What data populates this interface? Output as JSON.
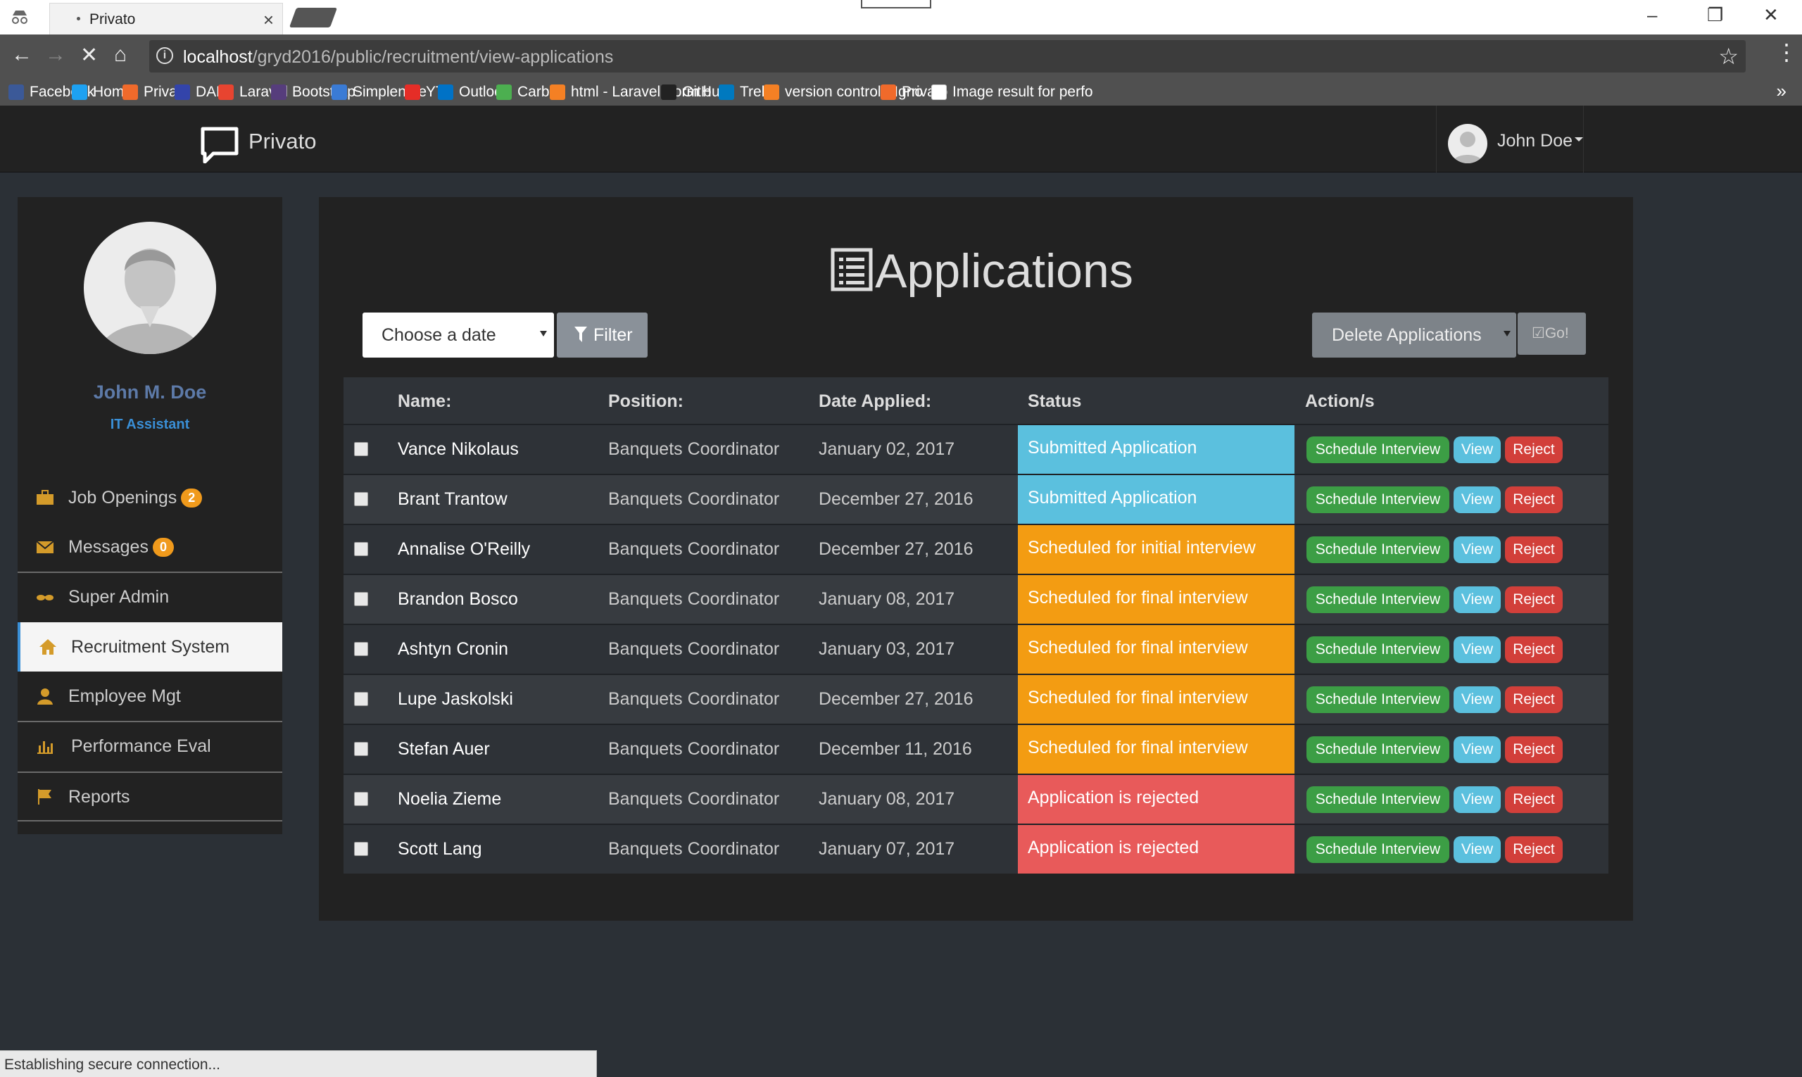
{
  "browser": {
    "tab_title": "Privato",
    "tab_close": "×",
    "url_host": "localhost",
    "url_path": "/gryd2016/public/recruitment/view-applications",
    "bookmarks": [
      {
        "label": "Facebook",
        "color": "#3b5998"
      },
      {
        "label": "Home",
        "color": "#1da1f2"
      },
      {
        "label": "Privato",
        "color": "#f06a2b"
      },
      {
        "label": "DAP",
        "color": "#3344aa"
      },
      {
        "label": "Laravel",
        "color": "#e74430"
      },
      {
        "label": "Bootstrap",
        "color": "#563d7c"
      },
      {
        "label": "Simplenote",
        "color": "#3a7bd5"
      },
      {
        "label": "YT",
        "color": "#e52d27"
      },
      {
        "label": "Outlook",
        "color": "#0072c6"
      },
      {
        "label": "Carbon",
        "color": "#4caf50"
      },
      {
        "label": "html - Laravel Form b",
        "color": "#f48024"
      },
      {
        "label": "GitHub",
        "color": "#222222"
      },
      {
        "label": "Trello",
        "color": "#0079bf"
      },
      {
        "label": "version control - Igno",
        "color": "#f48024"
      },
      {
        "label": "Privato",
        "color": "#f06a2b"
      },
      {
        "label": "Image result for perfo",
        "color": "#ffffff"
      }
    ],
    "bookmarks_more": "»",
    "status_text": "Establishing secure connection..."
  },
  "navbar": {
    "brand": "Privato",
    "user_name": "John Doe"
  },
  "sidebar": {
    "profile_name": "John M. Doe",
    "profile_role": "IT Assistant",
    "items": [
      {
        "label": "Job Openings",
        "badge": "2",
        "icon": "briefcase-icon"
      },
      {
        "label": "Messages",
        "badge": "0",
        "icon": "envelope-icon"
      },
      {
        "label": "Super Admin",
        "icon": "sunglasses-icon"
      },
      {
        "label": "Recruitment System",
        "icon": "home-icon",
        "active": true
      },
      {
        "label": "Employee Mgt",
        "icon": "user-icon"
      },
      {
        "label": "Performance Eval",
        "icon": "bar-chart-icon"
      },
      {
        "label": "Reports",
        "icon": "flag-icon"
      }
    ]
  },
  "main": {
    "title": "Applications",
    "date_select": "Choose a date",
    "filter_label": "Filter",
    "bulk_action": "Delete Applications",
    "go_label": "Go!",
    "columns": [
      "Name:",
      "Position:",
      "Date Applied:",
      "Status",
      "Action/s"
    ],
    "actions": {
      "schedule": "Schedule Interview",
      "view": "View",
      "reject": "Reject"
    },
    "rows": [
      {
        "name": "Vance Nikolaus",
        "position": "Banquets Coordinator",
        "date": "January 02, 2017",
        "status": "Submitted Application",
        "status_type": "submitted"
      },
      {
        "name": "Brant Trantow",
        "position": "Banquets Coordinator",
        "date": "December 27, 2016",
        "status": "Submitted Application",
        "status_type": "submitted"
      },
      {
        "name": "Annalise O'Reilly",
        "position": "Banquets Coordinator",
        "date": "December 27, 2016",
        "status": "Scheduled for initial interview",
        "status_type": "scheduled"
      },
      {
        "name": "Brandon Bosco",
        "position": "Banquets Coordinator",
        "date": "January 08, 2017",
        "status": "Scheduled for final interview",
        "status_type": "scheduled"
      },
      {
        "name": "Ashtyn Cronin",
        "position": "Banquets Coordinator",
        "date": "January 03, 2017",
        "status": "Scheduled for final interview",
        "status_type": "scheduled"
      },
      {
        "name": "Lupe Jaskolski",
        "position": "Banquets Coordinator",
        "date": "December 27, 2016",
        "status": "Scheduled for final interview",
        "status_type": "scheduled"
      },
      {
        "name": "Stefan Auer",
        "position": "Banquets Coordinator",
        "date": "December 11, 2016",
        "status": "Scheduled for final interview",
        "status_type": "scheduled"
      },
      {
        "name": "Noelia Zieme",
        "position": "Banquets Coordinator",
        "date": "January 08, 2017",
        "status": "Application is rejected",
        "status_type": "rejected"
      },
      {
        "name": "Scott Lang",
        "position": "Banquets Coordinator",
        "date": "January 07, 2017",
        "status": "Application is rejected",
        "status_type": "rejected"
      }
    ]
  },
  "colors": {
    "submitted": "#5bc0de",
    "scheduled": "#f39c12",
    "rejected": "#e85a5a",
    "badge": "#f09a1c",
    "accent": "#3a8fd6"
  }
}
